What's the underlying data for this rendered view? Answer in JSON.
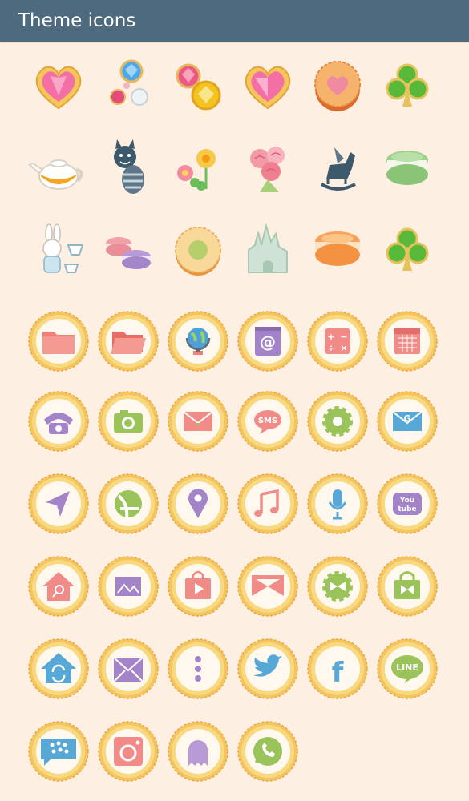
{
  "header": {
    "title": "Theme icons"
  },
  "colors": {
    "header_bg": "#4d6a7e",
    "page_bg": "#fdf0e2",
    "frame_gold": "#efc15a",
    "frame_inner": "#fff8ee"
  },
  "icons": [
    {
      "name": "pink-gem-heart"
    },
    {
      "name": "jewel-balls"
    },
    {
      "name": "pink-yellow-gems"
    },
    {
      "name": "heart-gem"
    },
    {
      "name": "heart-cookie"
    },
    {
      "name": "green-clover-gems"
    },
    {
      "name": "teapot"
    },
    {
      "name": "cheshire-cat"
    },
    {
      "name": "flowers"
    },
    {
      "name": "roses-bouquet"
    },
    {
      "name": "pegasus-rocking-horse"
    },
    {
      "name": "green-macaron"
    },
    {
      "name": "rabbit-teacups"
    },
    {
      "name": "macarons"
    },
    {
      "name": "jam-cookie"
    },
    {
      "name": "castle"
    },
    {
      "name": "orange-macaron"
    },
    {
      "name": "clover-gems"
    },
    {
      "name": "folder"
    },
    {
      "name": "open-folder"
    },
    {
      "name": "globe"
    },
    {
      "name": "email-notepad"
    },
    {
      "name": "calculator"
    },
    {
      "name": "calendar"
    },
    {
      "name": "phone"
    },
    {
      "name": "camera"
    },
    {
      "name": "mail-envelope"
    },
    {
      "name": "sms-bubble",
      "label": "SMS"
    },
    {
      "name": "settings-gear"
    },
    {
      "name": "gmail-envelope",
      "label": "G"
    },
    {
      "name": "navigation-arrow"
    },
    {
      "name": "maps"
    },
    {
      "name": "location-pin"
    },
    {
      "name": "music-note"
    },
    {
      "name": "microphone"
    },
    {
      "name": "youtube",
      "label": "You tube"
    },
    {
      "name": "home-search"
    },
    {
      "name": "gallery"
    },
    {
      "name": "play-store"
    },
    {
      "name": "ribbon-bow"
    },
    {
      "name": "settings-bow"
    },
    {
      "name": "shopping-bag"
    },
    {
      "name": "sync-home"
    },
    {
      "name": "mail-box"
    },
    {
      "name": "menu-dots"
    },
    {
      "name": "twitter-bird"
    },
    {
      "name": "facebook",
      "label": "f"
    },
    {
      "name": "line-bubble",
      "label": "LINE"
    },
    {
      "name": "blackberry-messenger"
    },
    {
      "name": "instagram"
    },
    {
      "name": "snapchat-ghost"
    },
    {
      "name": "whatsapp"
    }
  ]
}
